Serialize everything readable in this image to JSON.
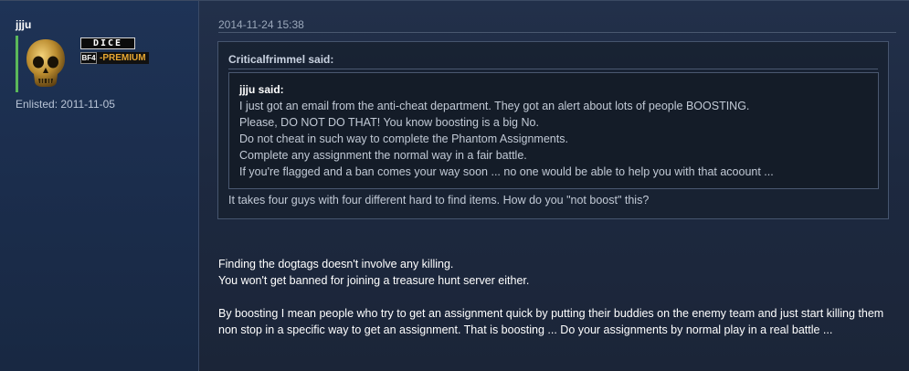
{
  "author": {
    "username": "jjju",
    "badges": {
      "dice": "DICE",
      "bf4": "BF4",
      "premium": "-PREMIUM"
    },
    "enlisted": "Enlisted: 2011-11-05"
  },
  "post": {
    "timestamp": "2014-11-24 15:38",
    "quote": {
      "author": "Criticalfrimmel said:",
      "nested": {
        "author": "jjju said:",
        "lines": [
          "I just got an email from the anti-cheat department. They got an alert about lots of people BOOSTING.",
          "Please, DO NOT DO THAT! You know boosting is a big No.",
          "Do not cheat in such way to complete the Phantom Assignments.",
          "Complete any assignment the normal way in a fair battle.",
          "If you're flagged and a ban comes your way soon ... no one would be able to help you with that acoount ..."
        ]
      },
      "reply": "It takes four guys with four different hard to find items. How do you \"not boost\" this?"
    },
    "body": {
      "line1": "Finding the dogtags doesn't involve any killing.",
      "line2": "You won't get banned for joining a treasure hunt server either.",
      "line3": "By boosting I mean people who try to get an assignment quick by putting their buddies on the enemy team and just start killing them non stop in a specific way to get an assignment. That is boosting ... Do your assignments by normal play in a real battle ..."
    }
  },
  "colors": {
    "accent_bar": "#5bb85a",
    "premium": "#e8a832"
  },
  "icons": {
    "avatar": "golden-skull-icon"
  }
}
